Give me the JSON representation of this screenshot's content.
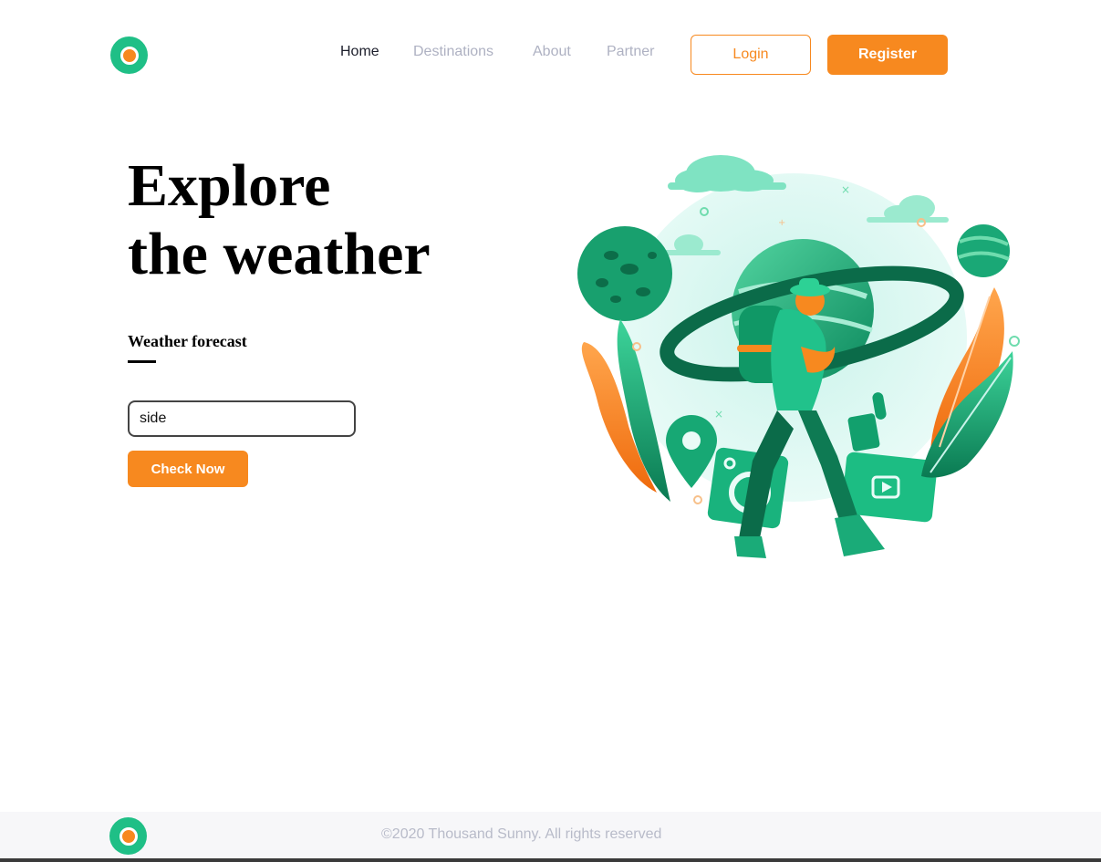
{
  "header": {
    "logo_icon": "brand-logo",
    "nav": {
      "home": "Home",
      "destinations": "Destinations",
      "about": "About",
      "partner": "Partner"
    },
    "login_label": "Login",
    "register_label": "Register"
  },
  "hero": {
    "title_line1": "Explore",
    "title_line2": "the weather",
    "section_label": "Weather forecast",
    "input_value": "side",
    "check_button_label": "Check Now",
    "illustration": "traveler-with-backpack-planets-leaves-illustration"
  },
  "footer": {
    "logo_icon": "brand-logo",
    "copyright": "©2020 Thousand Sunny. All rights reserved"
  },
  "colors": {
    "brand_green": "#1fbf86",
    "brand_orange": "#f7891f",
    "nav_active": "#1c1e2b",
    "nav_inactive": "#aeb1c2"
  }
}
